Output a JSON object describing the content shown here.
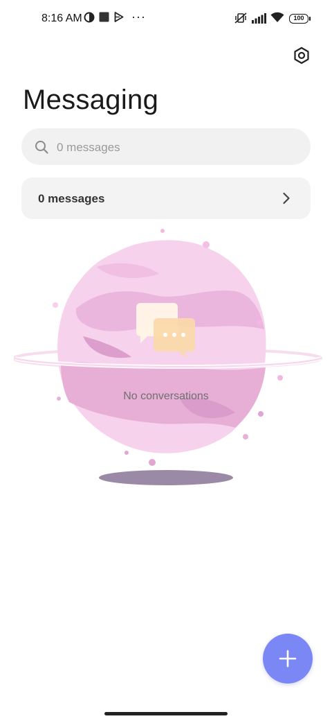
{
  "status_bar": {
    "time": "8:16 AM",
    "more": "···",
    "battery": "100",
    "icons": [
      "data-saver-icon",
      "stop-square-icon",
      "play-store-icon",
      "vibrate-off-icon",
      "signal-icon",
      "wifi-icon",
      "battery-icon"
    ]
  },
  "header": {
    "title": "Messaging",
    "settings_icon": "settings-icon"
  },
  "search": {
    "placeholder": "0 messages",
    "value": ""
  },
  "messages_row": {
    "label": "0 messages",
    "icon": "chevron-right-icon"
  },
  "empty_state": {
    "text": "No conversations"
  },
  "fab": {
    "icon": "plus-icon",
    "color": "#7b87f5"
  },
  "colors": {
    "accent": "#7b87f5",
    "planet": "#f3c6e8",
    "shadow": "#9a8aa6"
  }
}
